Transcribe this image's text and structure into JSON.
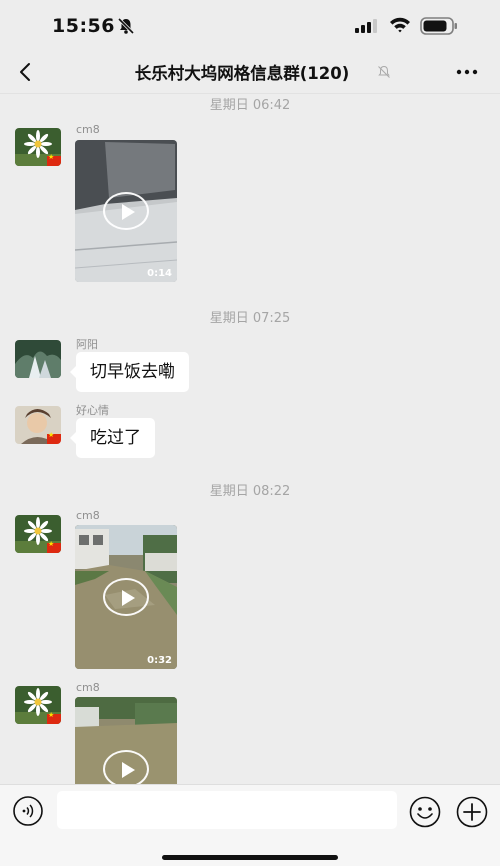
{
  "status_bar": {
    "time": "15:56"
  },
  "header": {
    "title": "长乐村大坞网格信息群(120)",
    "back_icon": "chevron-left-icon",
    "more_icon": "ellipsis-icon",
    "mute_icon": "bell-slash-icon"
  },
  "messages": [
    {
      "kind": "time",
      "text": "星期日 06:42"
    },
    {
      "kind": "video",
      "sender": "cm8",
      "duration": "0:14"
    },
    {
      "kind": "time",
      "text": "星期日 07:25"
    },
    {
      "kind": "text",
      "sender": "阿阳",
      "text": "切早饭去嘞"
    },
    {
      "kind": "text",
      "sender": "好心情",
      "text": "吃过了"
    },
    {
      "kind": "time",
      "text": "星期日 08:22"
    },
    {
      "kind": "video",
      "sender": "cm8",
      "duration": "0:32"
    },
    {
      "kind": "video",
      "sender": "cm8",
      "duration": ""
    }
  ],
  "input_bar": {
    "voice_icon": "voice-icon",
    "emoji_icon": "emoji-icon",
    "plus_icon": "plus-icon",
    "input_value": ""
  }
}
